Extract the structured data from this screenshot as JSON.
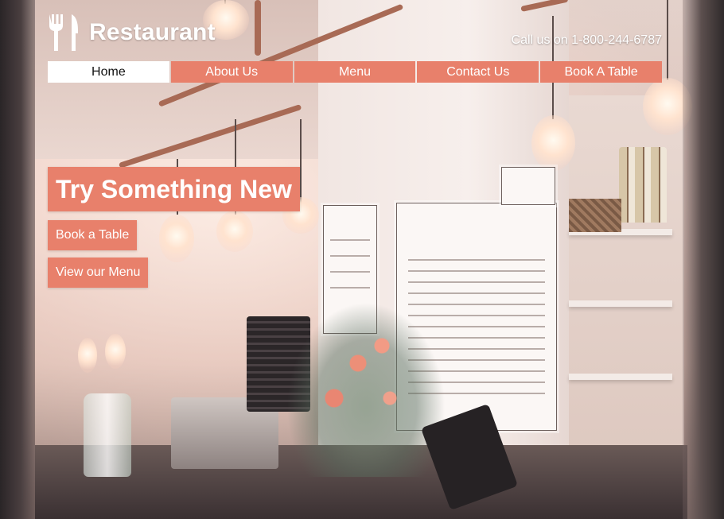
{
  "brand": {
    "icon": "fork-knife-icon",
    "title": "Restaurant"
  },
  "header": {
    "phone": "Call us on 1-800-244-6787"
  },
  "nav": {
    "items": [
      {
        "label": "Home",
        "active": true
      },
      {
        "label": "About Us",
        "active": false
      },
      {
        "label": "Menu",
        "active": false
      },
      {
        "label": "Contact Us",
        "active": false
      },
      {
        "label": "Book A Table",
        "active": false
      }
    ]
  },
  "hero": {
    "title": "Try Something New",
    "book_button": "Book a Table",
    "menu_button": "View our Menu"
  },
  "colors": {
    "accent": "#e8806b",
    "active_nav_bg": "#ffffff",
    "text_light": "#ffffff",
    "text_dark": "#111111"
  }
}
